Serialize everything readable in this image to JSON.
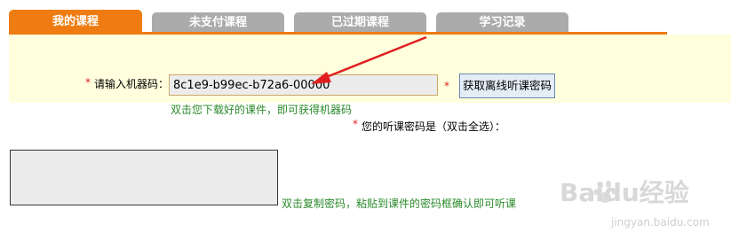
{
  "tabs": [
    {
      "label": "我的课程",
      "active": true
    },
    {
      "label": "未支付课程",
      "active": false
    },
    {
      "label": "已过期课程",
      "active": false
    },
    {
      "label": "学习记录",
      "active": false
    }
  ],
  "form": {
    "required_mark": "*",
    "machine_code_label": "请输入机器码：",
    "machine_code_value": "8c1e9-b99ec-b72a6-00000",
    "get_password_button": "获取离线听课密码",
    "machine_code_hint": "双击您下载好的课件，即可获得机器码",
    "password_label": "您的听课密码是（双击全选）：",
    "password_value": "",
    "password_hint": "双击复制密码，粘贴到课件的密码框确认即可听课"
  },
  "watermark": {
    "brand": "Baidu经验",
    "url": "jingyan.baidu.com"
  },
  "colors": {
    "accent": "#ee7c12",
    "tab_inactive": "#ababab",
    "panel_bg": "#ffffdd",
    "hint": "#2a8a2a",
    "required": "#e02020",
    "arrow": "#e02020"
  }
}
